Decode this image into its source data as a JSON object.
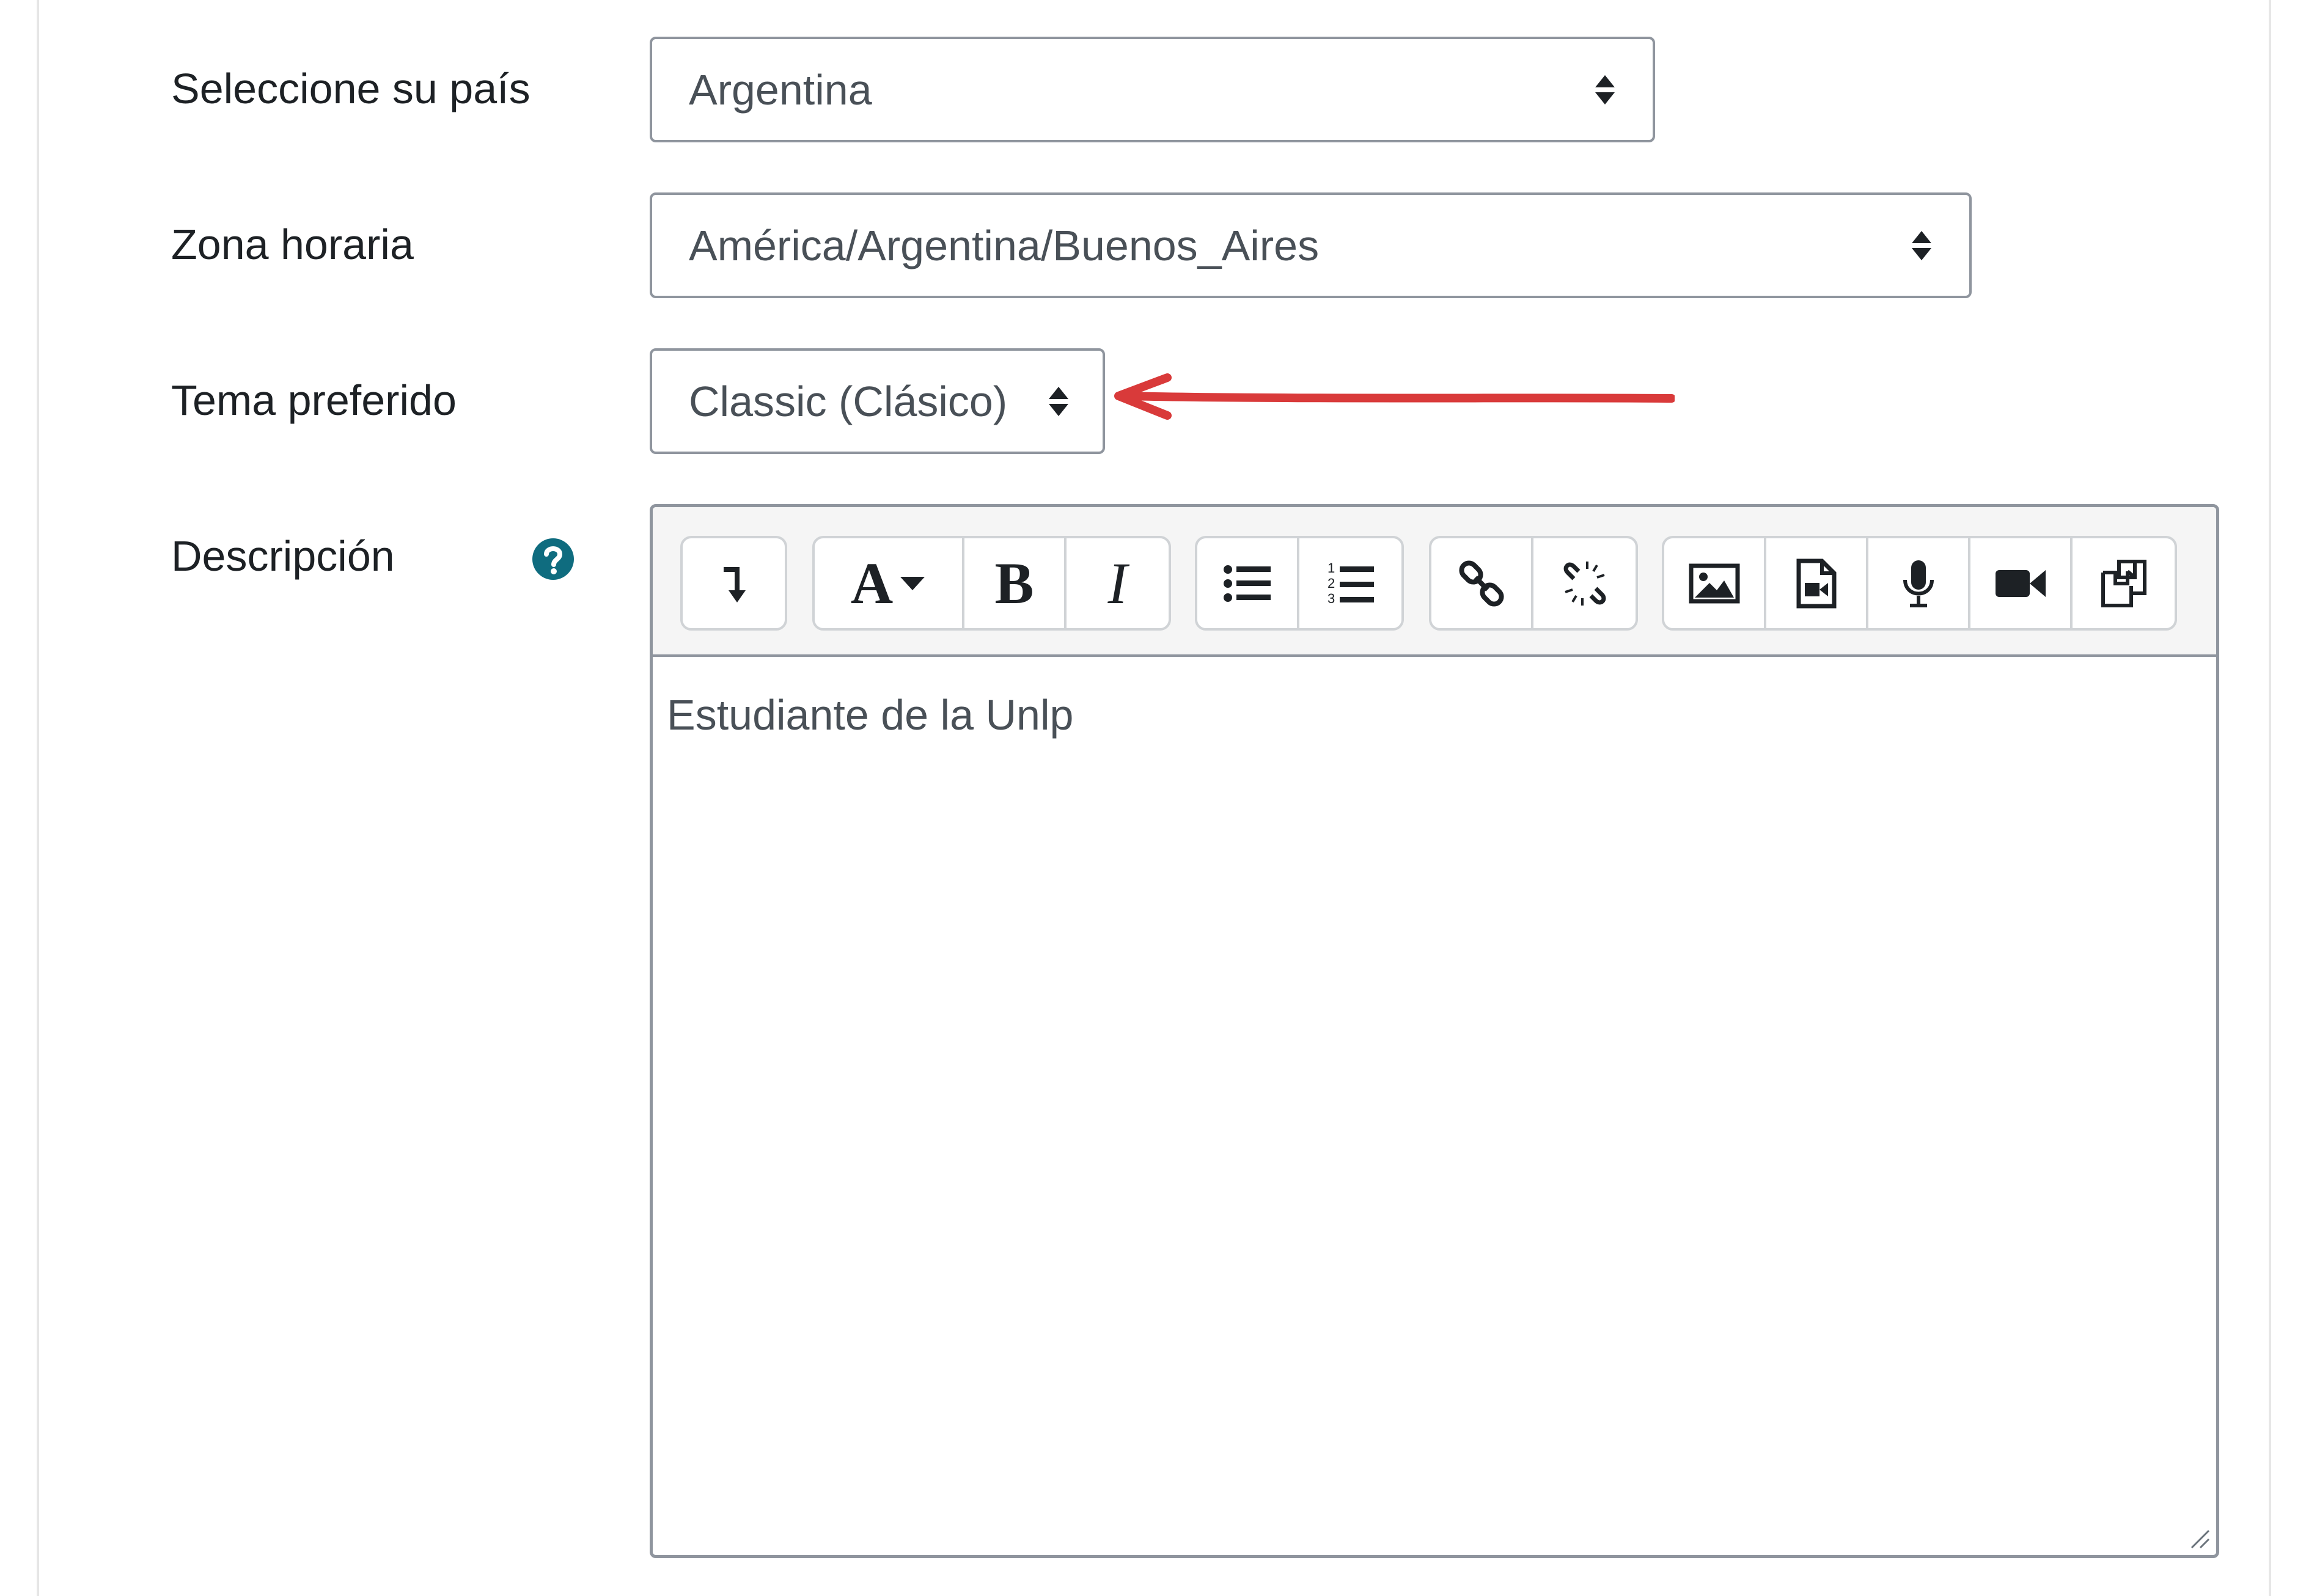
{
  "form": {
    "country": {
      "label": "Seleccione su país",
      "value": "Argentina"
    },
    "timezone": {
      "label": "Zona horaria",
      "value": "América/Argentina/Buenos_Aires"
    },
    "theme": {
      "label": "Tema preferido",
      "value": "Classic (Clásico)"
    },
    "description": {
      "label": "Descripción",
      "help_icon": "question-circle-icon",
      "content": "Estudiante de la Unlp"
    }
  },
  "toolbar": {
    "groups": [
      [
        "show-more-icon"
      ],
      [
        "font-style-icon",
        "bold-icon",
        "italic-icon"
      ],
      [
        "unordered-list-icon",
        "ordered-list-icon"
      ],
      [
        "link-icon",
        "unlink-icon"
      ],
      [
        "image-icon",
        "media-icon",
        "record-audio-icon",
        "record-video-icon",
        "manage-files-icon"
      ]
    ],
    "font_style_glyph": "A",
    "bold_glyph": "B",
    "italic_glyph": "I",
    "show_more_glyph": "↴"
  },
  "colors": {
    "help_icon": "#0f6c7f",
    "annotation_arrow": "#d93a3a",
    "border": "#8f959e"
  }
}
